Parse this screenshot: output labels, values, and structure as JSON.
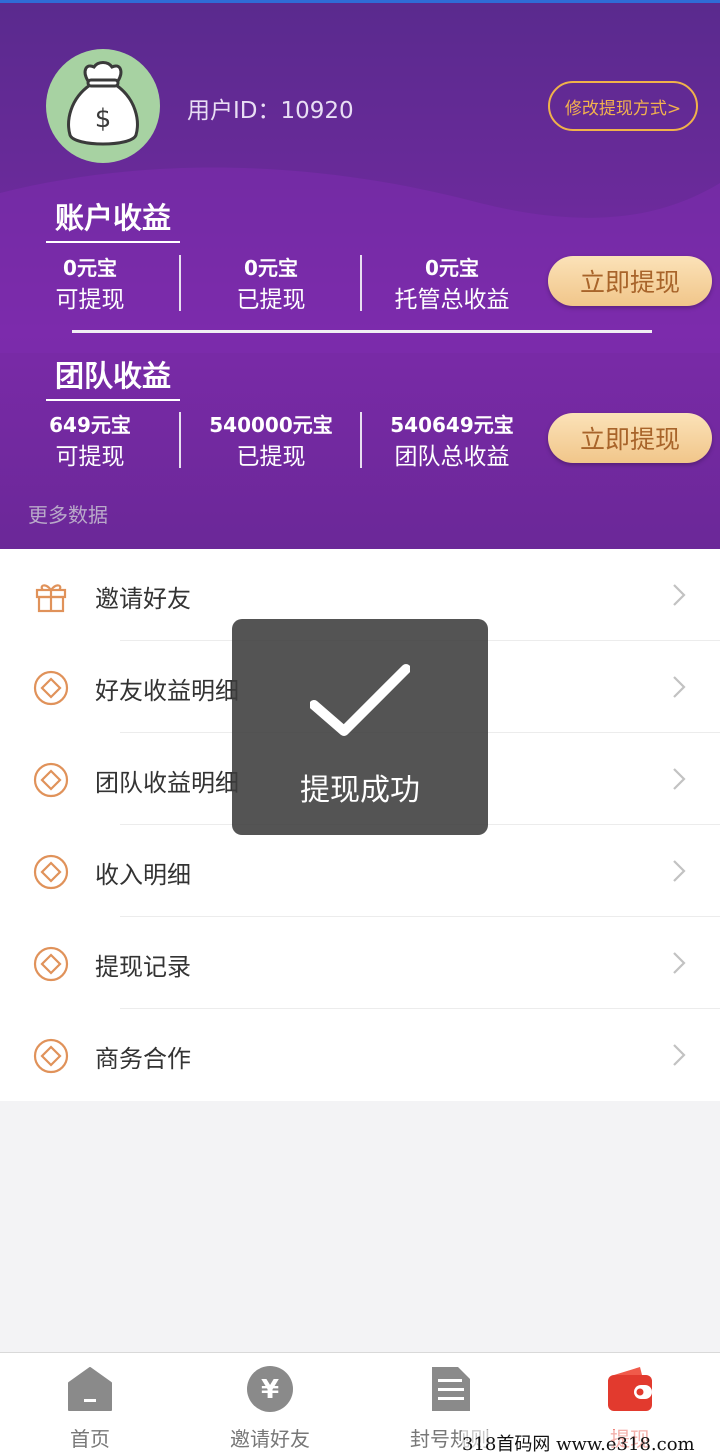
{
  "user": {
    "id_label": "用户ID：10920",
    "avatar_icon": "money-bag-icon"
  },
  "header": {
    "modify_button": "修改提现方式>"
  },
  "account": {
    "title": "账户收益",
    "stats": [
      {
        "value": "0元宝",
        "label": "可提现"
      },
      {
        "value": "0元宝",
        "label": "已提现"
      },
      {
        "value": "0元宝",
        "label": "托管总收益"
      }
    ],
    "withdraw_button": "立即提现"
  },
  "team": {
    "title": "团队收益",
    "stats": [
      {
        "value": "649元宝",
        "label": "可提现"
      },
      {
        "value": "540000元宝",
        "label": "已提现"
      },
      {
        "value": "540649元宝",
        "label": "团队总收益"
      }
    ],
    "withdraw_button": "立即提现"
  },
  "more_data": "更多数据",
  "menu": [
    {
      "label": "邀请好友",
      "icon": "gift-icon"
    },
    {
      "label": "好友收益明细",
      "icon": "diamond-coin-icon"
    },
    {
      "label": "团队收益明细",
      "icon": "diamond-coin-icon"
    },
    {
      "label": "收入明细",
      "icon": "diamond-coin-icon"
    },
    {
      "label": "提现记录",
      "icon": "diamond-coin-icon"
    },
    {
      "label": "商务合作",
      "icon": "diamond-coin-icon"
    }
  ],
  "toast": {
    "text": "提现成功",
    "icon": "checkmark-icon"
  },
  "tabs": [
    {
      "label": "首页",
      "icon": "home-icon"
    },
    {
      "label": "邀请好友",
      "icon": "yen-coin-icon"
    },
    {
      "label": "封号规则",
      "icon": "document-icon"
    },
    {
      "label": "提现",
      "icon": "wallet-icon",
      "active": true
    }
  ],
  "watermark": "318首码网  www.e318.com",
  "colors": {
    "header": "#6a2a9a",
    "accent": "#f0b24a",
    "menu_icon": "#e0925a",
    "active_tab": "#e23a2e"
  }
}
